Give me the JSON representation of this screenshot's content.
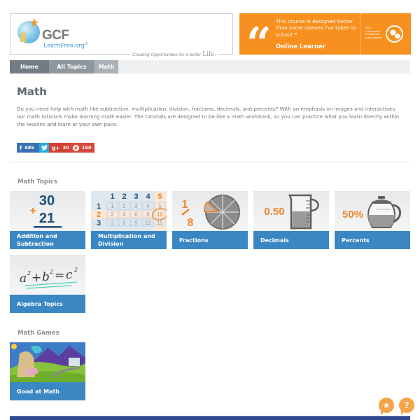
{
  "header": {
    "logo": {
      "brand": "GCF",
      "sub": "LearnFree.org",
      "registered": "®"
    },
    "tagline": "Creating Opportunities for a better",
    "tagline_life": "Life.",
    "testimonial": {
      "quote": "This course is designed better than some classes I've taken in school.",
      "close_quote": "”",
      "author": "Online Learner"
    },
    "foundation": {
      "lines": [
        "GCF",
        "Community",
        "Foundation",
        "International"
      ]
    }
  },
  "breadcrumb": [
    {
      "label": "Home"
    },
    {
      "label": "All Topics"
    },
    {
      "label": "Math"
    }
  ],
  "page": {
    "title": "Math",
    "intro": "Do you need help with math like subtraction, multiplication, division, fractions, decimals, and percents? With an emphasis on images and interactives, our math tutorials make learning math easier. The tutorials are designed to be like a math workbook, so you can practice what you learn directly within the lessons and learn at your own pace."
  },
  "share": {
    "facebook": {
      "icon": "f",
      "count": "685"
    },
    "twitter": {
      "icon": "t"
    },
    "googleplus": {
      "icon": "g+",
      "count": "30"
    },
    "pinterest": {
      "icon": "p",
      "count": "150"
    }
  },
  "math_topics": {
    "heading": "Math Topics",
    "tiles": [
      {
        "label_line1": "Addition and",
        "label_line2": "Subtraction",
        "art": {
          "top": "30",
          "op": "+",
          "bottom": "21"
        }
      },
      {
        "label_line1": "Multiplication and",
        "label_line2": "Division",
        "art": {
          "cols": [
            "1",
            "2",
            "3",
            "4",
            "5"
          ],
          "rows": [
            "1",
            "2",
            "3"
          ],
          "grid": [
            [
              "1",
              "2",
              "3",
              "4",
              "5"
            ],
            [
              "2",
              "4",
              "6",
              "8",
              "10"
            ],
            [
              "3",
              "6",
              "9",
              "12",
              "15"
            ]
          ]
        }
      },
      {
        "label_line1": "Fractions",
        "art": {
          "num": "1",
          "den": "8"
        }
      },
      {
        "label_line1": "Decimals",
        "art": {
          "value": "0.50"
        }
      },
      {
        "label_line1": "Percents",
        "art": {
          "value": "50%"
        }
      },
      {
        "label_line1": "Algebra Topics",
        "art": {
          "equation_a": "a",
          "equation_b": "b",
          "equation_c": "c",
          "exp": "2",
          "plus": "+",
          "equals": "="
        }
      }
    ]
  },
  "math_games": {
    "heading": "Math Games",
    "tiles": [
      {
        "label_line1": "Good at Math"
      }
    ]
  },
  "floating": {
    "favorite_icon": "★",
    "help_icon": "?"
  },
  "colors": {
    "accent_orange": "#f7901e",
    "tile_blue": "#3b87c3",
    "footer_navy": "#2f4890"
  }
}
